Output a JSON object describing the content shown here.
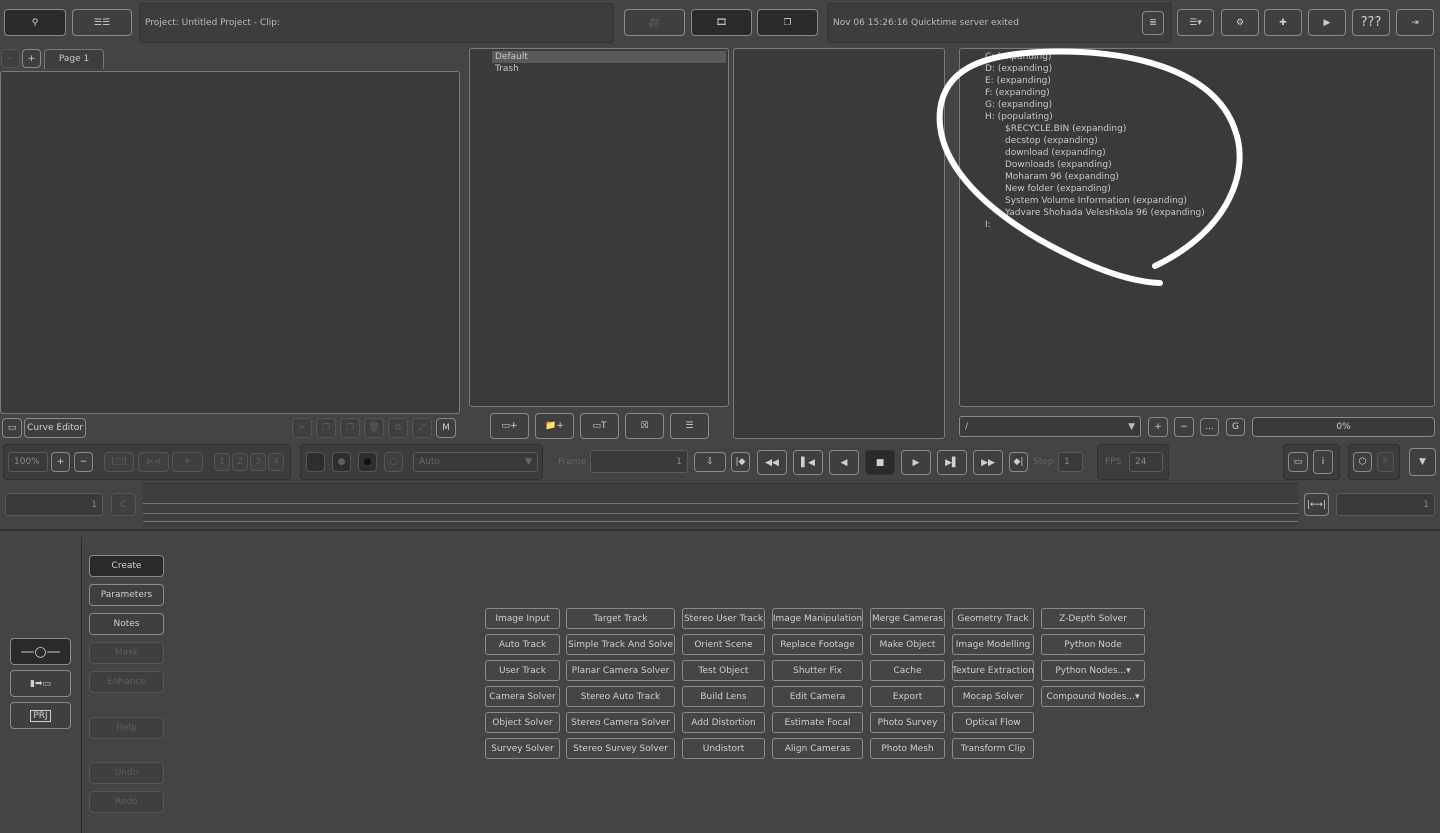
{
  "header": {
    "project": "Project: Untitled Project - Clip:",
    "status": "Nov 06 15:26:16 Quicktime server exited",
    "help_label": "???"
  },
  "left_panel": {
    "tab": "Page 1",
    "curve_editor": "Curve Editor",
    "m_label": "M"
  },
  "clip_bin": {
    "items": [
      "Default",
      "Trash"
    ]
  },
  "file_browser": {
    "drives": [
      "C: (expanding)",
      "D: (expanding)",
      "E: (expanding)",
      "F: (expanding)",
      "G: (expanding)",
      "H: (populating)"
    ],
    "h_children": [
      "$RECYCLE.BIN (expanding)",
      "decstop (expanding)",
      "download (expanding)",
      "Downloads (expanding)",
      "Moharam 96 (expanding)",
      "New folder (expanding)",
      "System Volume Information (expanding)",
      "Yadvare Shohada Veleshkola 96 (expanding)"
    ],
    "last_drive": "I:",
    "path": "/",
    "g_label": "G",
    "more_label": "...",
    "progress_text": "0%",
    "progress": 0
  },
  "viewer": {
    "zoom": "100%",
    "views": [
      "1",
      "2",
      "3",
      "4"
    ],
    "mode": "Auto",
    "frame_label": "Frame",
    "frame": "1",
    "step_label": "Step",
    "step": "1",
    "fps_label": "FPS",
    "fps": "24",
    "p_label": "P"
  },
  "timeline": {
    "start": "1",
    "c_label": "C",
    "end": "1"
  },
  "side_tabs": {
    "create": "Create",
    "parameters": "Parameters",
    "notes": "Notes",
    "mask": "Mask",
    "enhance": "Enhance",
    "help": "Help",
    "undo": "Undo",
    "redo": "Redo",
    "prj": "PRJ"
  },
  "nodes": [
    [
      "Image Input",
      "Auto Track",
      "User Track",
      "Camera Solver",
      "Object Solver",
      "Survey Solver"
    ],
    [
      "Target Track",
      "Simple Track And Solve",
      "Planar Camera Solver",
      "Stereo Auto Track",
      "Stereo Camera Solver",
      "Stereo Survey Solver"
    ],
    [
      "Stereo User Track",
      "Orient Scene",
      "Test Object",
      "Build Lens",
      "Add Distortion",
      "Undistort"
    ],
    [
      "Image Manipulation",
      "Replace Footage",
      "Shutter Fix",
      "Edit Camera",
      "Estimate Focal",
      "Align Cameras"
    ],
    [
      "Merge Cameras",
      "Make Object",
      "Cache",
      "Export",
      "Photo Survey",
      "Photo Mesh"
    ],
    [
      "Geometry Track",
      "Image Modelling",
      "Texture Extraction",
      "Mocap Solver",
      "Optical Flow",
      "Transform Clip"
    ],
    [
      "Z-Depth Solver",
      "Python Node",
      "Python Nodes...",
      "Compound Nodes..."
    ]
  ]
}
